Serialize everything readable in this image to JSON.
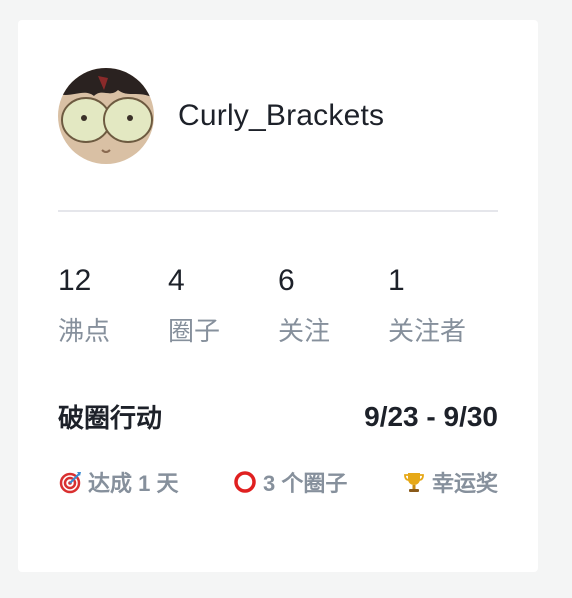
{
  "profile": {
    "username": "Curly_Brackets",
    "avatar_icon": "cartoon-face-avatar"
  },
  "stats": [
    {
      "value": "12",
      "label": "沸点"
    },
    {
      "value": "4",
      "label": "圈子"
    },
    {
      "value": "6",
      "label": "关注"
    },
    {
      "value": "1",
      "label": "关注者"
    }
  ],
  "activity": {
    "title": "破圈行动",
    "date_range": "9/23 - 9/30"
  },
  "badges": [
    {
      "icon": "target-icon",
      "text": "达成 1 天"
    },
    {
      "icon": "ring-icon",
      "text": "3 个圈子"
    },
    {
      "icon": "trophy-icon",
      "text": "幸运奖"
    }
  ],
  "colors": {
    "background": "#f4f5f5",
    "card": "#ffffff",
    "text_primary": "#1d2129",
    "text_secondary": "#86909c",
    "divider": "#e5e6eb"
  }
}
